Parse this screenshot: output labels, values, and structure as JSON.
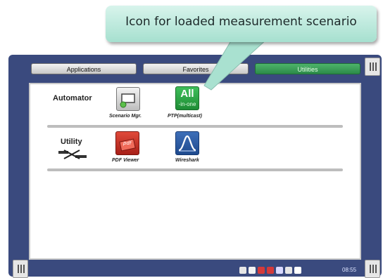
{
  "callout": {
    "text": "Icon for loaded measurement scenario"
  },
  "tabs": [
    {
      "label": "Applications",
      "active": false
    },
    {
      "label": "Favorites",
      "active": false
    },
    {
      "label": "Utilities",
      "active": true
    }
  ],
  "sections": [
    {
      "label": "Automator",
      "apps": [
        {
          "label": "Scenario Mgr.",
          "icon": "scenario-manager-icon"
        },
        {
          "label": "PTP(multicast)",
          "icon": "all-in-one-icon",
          "icon_text": "All",
          "icon_subtext": "-in-one"
        }
      ]
    },
    {
      "label": "Utility",
      "apps": [
        {
          "label": "PDF Viewer",
          "icon": "pdf-icon",
          "icon_text": "pdf"
        },
        {
          "label": "Wireshark",
          "icon": "wireshark-icon"
        }
      ]
    }
  ],
  "status_bar": {
    "time": "08:55"
  },
  "colors": {
    "frame": "#3a4a7e",
    "active_tab": "#2c8b49",
    "callout": "#a6e0cf"
  }
}
